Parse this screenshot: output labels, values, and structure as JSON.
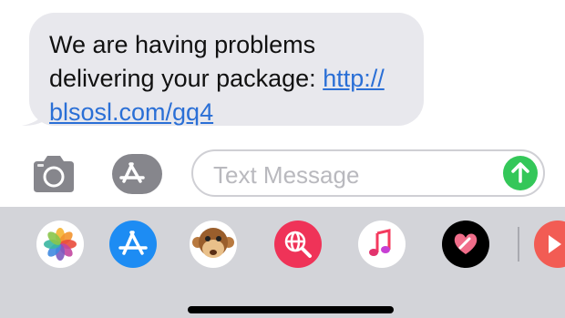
{
  "message": {
    "line1": "We are having problems",
    "line2_text": "delivering your package: ",
    "link_part1": "http://",
    "link_part2": "blsosl.com/gq4"
  },
  "compose": {
    "placeholder": "Text Message",
    "send_icon": "arrow-up-icon",
    "camera_icon": "camera-icon",
    "appstore_icon": "app-store-icon"
  },
  "app_drawer": {
    "apps": [
      "photos-icon",
      "app-store-icon",
      "animoji-monkey-icon",
      "web-search-icon",
      "music-icon",
      "digital-touch-icon",
      "partial-app-icon"
    ]
  },
  "colors": {
    "bubble": "#e8e8ed",
    "link": "#2a6fd6",
    "send": "#34c759",
    "drawer": "#d3d4d9"
  }
}
